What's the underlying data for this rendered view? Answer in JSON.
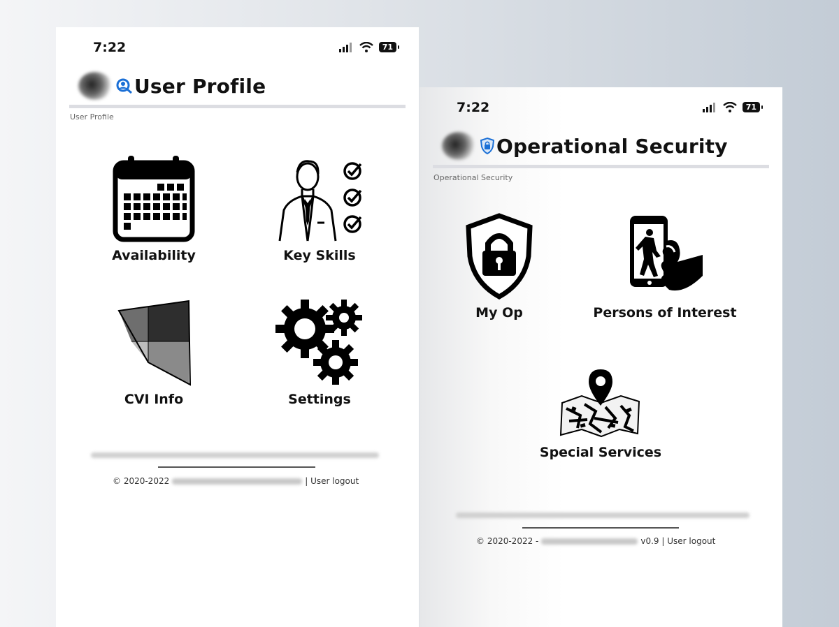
{
  "screen_left": {
    "status": {
      "time": "7:22",
      "battery": "71"
    },
    "title": "User Profile",
    "breadcrumb": "User Profile",
    "tiles": [
      {
        "label": "Availability",
        "icon": "calendar-icon"
      },
      {
        "label": "Key Skills",
        "icon": "person-checklist-icon"
      },
      {
        "label": "CVI Info",
        "icon": "cvi-shape-icon"
      },
      {
        "label": "Settings",
        "icon": "gears-icon"
      }
    ],
    "footer": {
      "copyright": "© 2020-2022",
      "logout": "| User logout"
    }
  },
  "screen_right": {
    "status": {
      "time": "7:22",
      "battery": "71"
    },
    "title": "Operational Security",
    "breadcrumb": "Operational Security",
    "tiles": [
      {
        "label": "My Op",
        "icon": "shield-lock-icon"
      },
      {
        "label": "Persons of Interest",
        "icon": "phone-in-hand-icon"
      },
      {
        "label": "Special Services",
        "icon": "map-pin-icon"
      }
    ],
    "footer": {
      "copyright": "© 2020-2022 -",
      "version_logout": "v0.9 | User logout"
    }
  }
}
